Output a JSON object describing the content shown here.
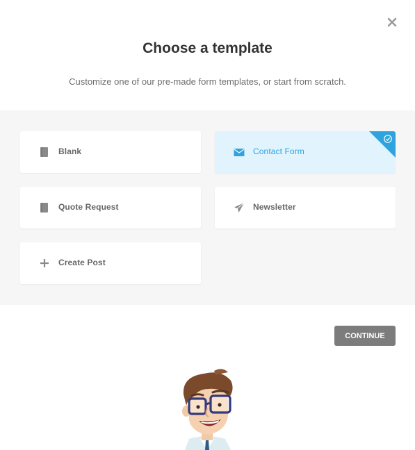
{
  "header": {
    "title": "Choose a template",
    "subtitle": "Customize one of our pre-made form templates, or start from scratch."
  },
  "templates": [
    {
      "label": "Blank",
      "icon": "book-icon",
      "selected": false
    },
    {
      "label": "Contact Form",
      "icon": "envelope-icon",
      "selected": true
    },
    {
      "label": "Quote Request",
      "icon": "book-icon",
      "selected": false
    },
    {
      "label": "Newsletter",
      "icon": "paper-plane-icon",
      "selected": false
    },
    {
      "label": "Create Post",
      "icon": "plus-icon",
      "selected": false
    }
  ],
  "footer": {
    "continue_label": "CONTINUE"
  },
  "colors": {
    "accent": "#2ea3dd",
    "selected_bg": "#e1f4fd",
    "button_bg": "#7c7c7c",
    "grid_bg": "#f6f6f6"
  }
}
